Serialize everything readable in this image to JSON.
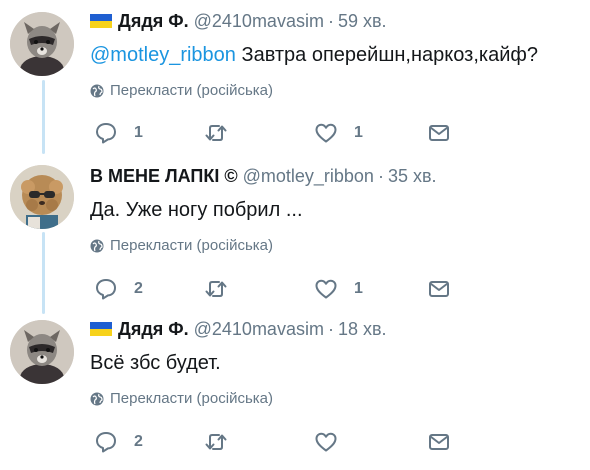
{
  "tweets": [
    {
      "author_name": "Дядя Ф.",
      "handle": "@2410mavasim",
      "separator": "·",
      "time": "59 хв.",
      "flag": true,
      "mention": "@motley_ribbon",
      "text": " Завтра оперейшн,наркоз,кайф?",
      "translate": "Перекласти (російська)",
      "replies": "1",
      "retweets": "",
      "likes": "1"
    },
    {
      "author_name": "В МЕНЕ ЛАПКІ ©",
      "handle": "@motley_ribbon",
      "separator": "·",
      "time": "35 хв.",
      "flag": false,
      "mention": "",
      "text": "Да. Уже ногу побрил ...",
      "translate": "Перекласти (російська)",
      "replies": "2",
      "retweets": "",
      "likes": "1"
    },
    {
      "author_name": "Дядя Ф.",
      "handle": "@2410mavasim",
      "separator": "·",
      "time": "18 хв.",
      "flag": true,
      "mention": "",
      "text": "Всё збс будет.",
      "translate": "Перекласти (російська)",
      "replies": "2",
      "retweets": "",
      "likes": ""
    }
  ],
  "colors": {
    "accent": "#1b95e0",
    "secondary_text": "#657786",
    "thread_line": "#c7e3f5"
  },
  "icons": {
    "reply": "reply-icon",
    "retweet": "retweet-icon",
    "like": "heart-icon",
    "dm": "envelope-icon",
    "translate": "globe-icon"
  }
}
